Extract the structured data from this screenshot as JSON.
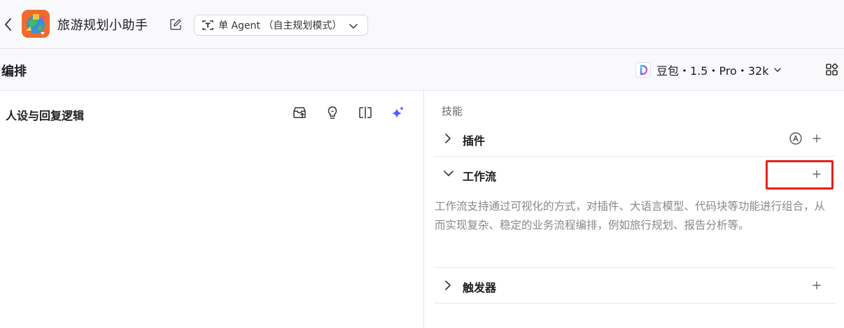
{
  "header": {
    "title": "旅游规划小助手",
    "mode_label": "单 Agent （自主规划模式）"
  },
  "subheader": {
    "label": "编排",
    "model_label": "豆包・1.5・Pro・32k"
  },
  "left_panel": {
    "heading": "人设与回复逻辑"
  },
  "right_panel": {
    "section_label": "技能",
    "plugins_title": "插件",
    "workflow_title": "工作流",
    "workflow_description": "工作流支持通过可视化的方式，对插件、大语言模型、代码块等功能进行组合，从而实现复杂、稳定的业务流程编排，例如旅行规划、报告分析等。",
    "triggers_title": "触发器"
  },
  "colors": {
    "accent": "#4e5bff",
    "highlight": "#e8201c",
    "avatar_bg": "#f06b2a"
  },
  "icons": [
    "back-icon",
    "edit-icon",
    "mode-icon",
    "chevron-down-icon",
    "model-logo-icon",
    "grid-icon",
    "import-icon",
    "bulb-icon",
    "split-icon",
    "sparkle-icon",
    "chevron-right-icon",
    "auto-icon",
    "plus-icon"
  ]
}
